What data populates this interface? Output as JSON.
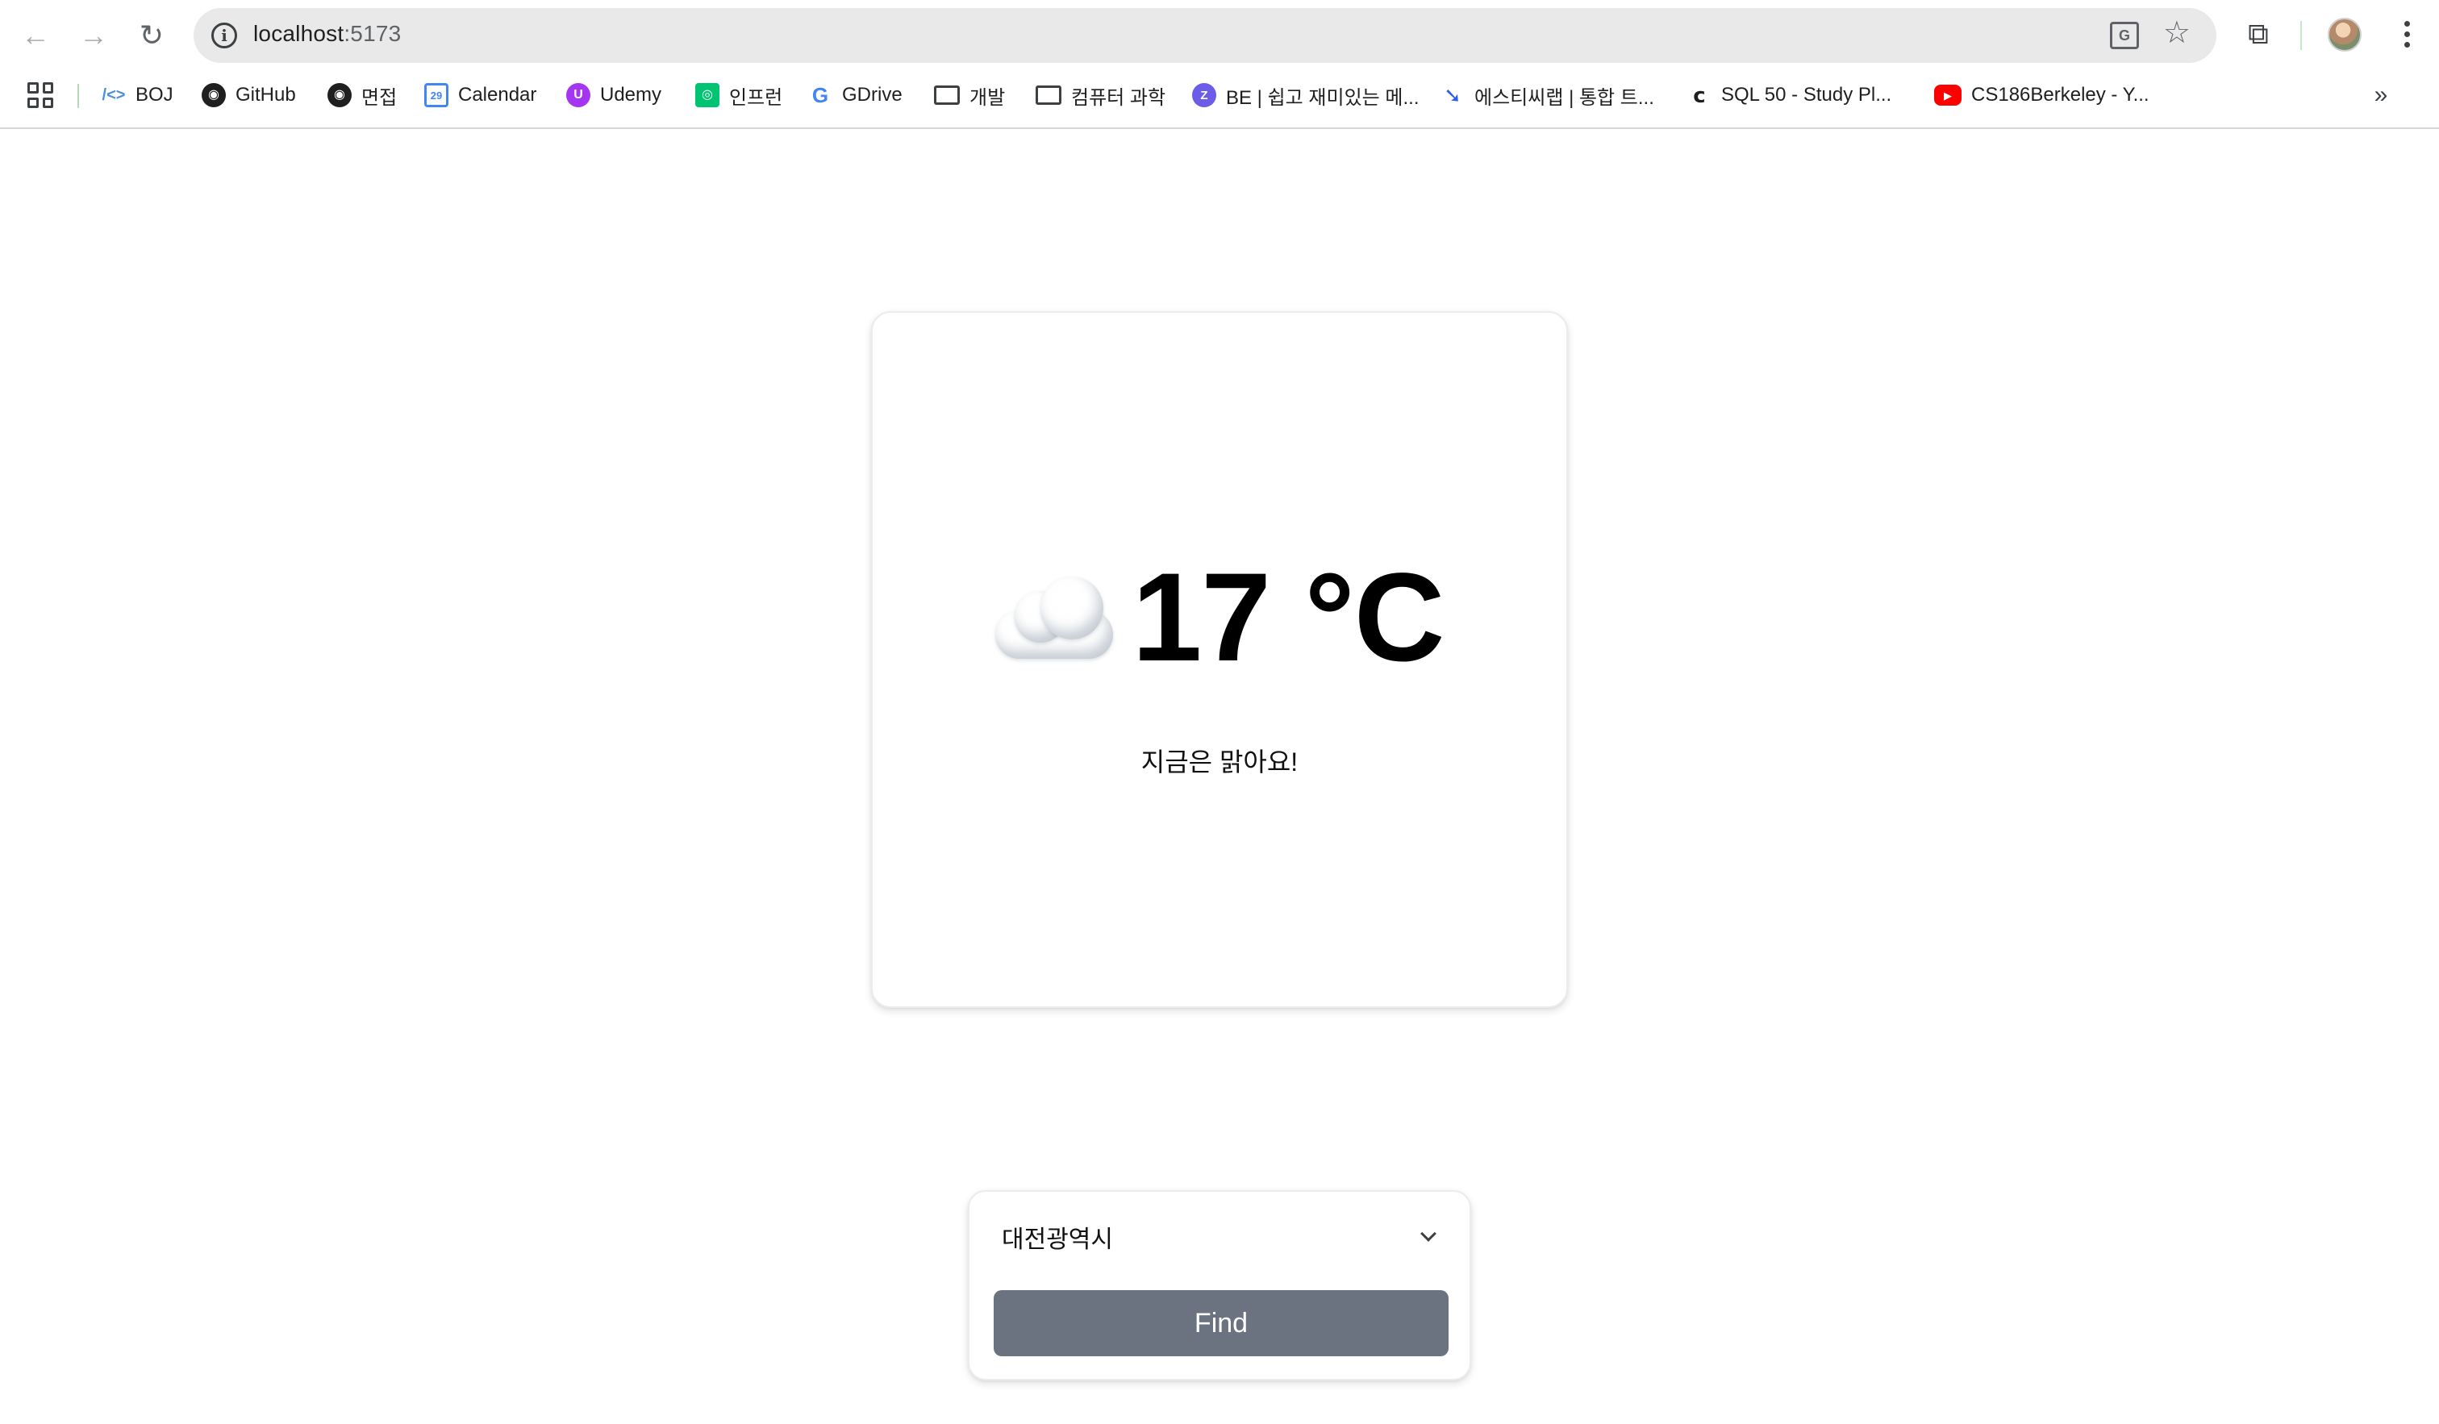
{
  "browser": {
    "url_host": "localhost",
    "url_port": ":5173",
    "bookmarks": [
      {
        "label": "BOJ",
        "icon": "code-icon"
      },
      {
        "label": "GitHub",
        "icon": "github-icon"
      },
      {
        "label": "면접",
        "icon": "github-icon"
      },
      {
        "label": "Calendar",
        "icon": "calendar-icon"
      },
      {
        "label": "Udemy",
        "icon": "udemy-icon"
      },
      {
        "label": "인프런",
        "icon": "inflearn-icon"
      },
      {
        "label": "GDrive",
        "icon": "google-icon"
      },
      {
        "label": "개발",
        "icon": "folder-icon"
      },
      {
        "label": "컴퓨터 과학",
        "icon": "folder-icon"
      },
      {
        "label": "BE | 쉽고 재미있는 메...",
        "icon": "be-icon"
      },
      {
        "label": "에스티씨랩 | 통합 트...",
        "icon": "stclab-icon"
      },
      {
        "label": "SQL 50 - Study Pl...",
        "icon": "leetcode-icon"
      },
      {
        "label": "CS186Berkeley - Y...",
        "icon": "youtube-icon"
      }
    ],
    "glyphs": {
      "back": "←",
      "forward": "→",
      "reload": "↻",
      "info": "i",
      "translate": "G",
      "star": "☆",
      "extensions": "⧉",
      "more_bookmarks": "»",
      "boj": "/<>",
      "github": "◉",
      "calendar": "29",
      "udemy": "U",
      "inflearn": "◎",
      "google": "G",
      "be": "Z",
      "stclab": "➘",
      "leetcode": "ⅽ",
      "youtube": "▶"
    }
  },
  "weather": {
    "icon": "cloud-icon",
    "temperature": "17 °C",
    "status": "지금은 맑아요!"
  },
  "search": {
    "selected_city": "대전광역시",
    "find_label": "Find"
  },
  "colors": {
    "find_button": "#6b7280",
    "card_border": "#ececec"
  }
}
